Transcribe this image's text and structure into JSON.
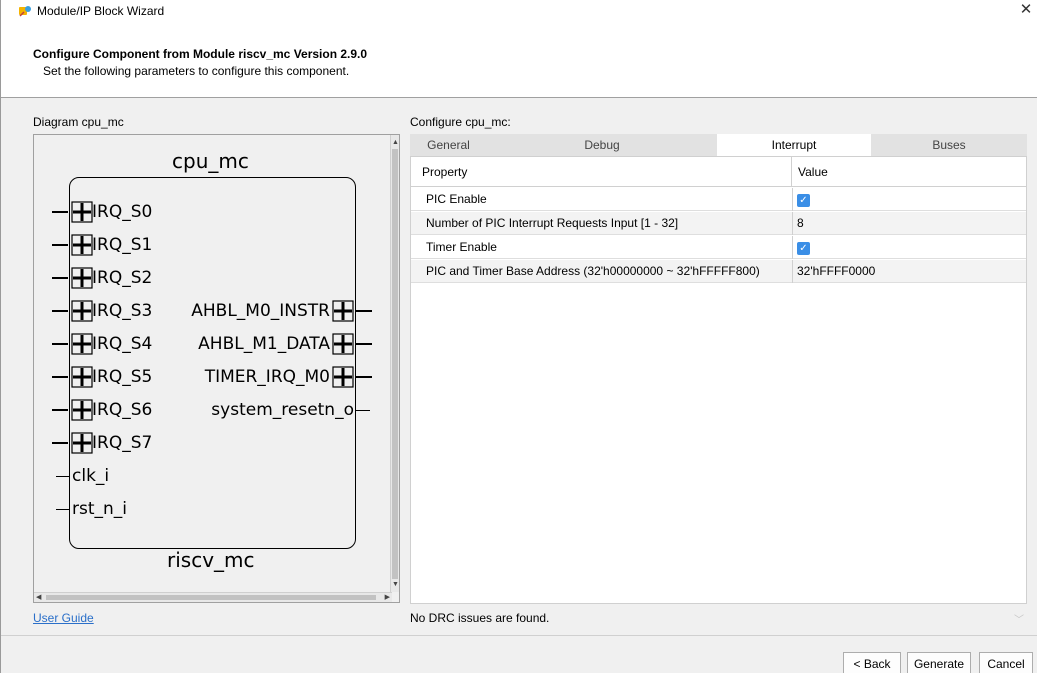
{
  "window": {
    "title": "Module/IP Block Wizard",
    "close_glyph": "✕"
  },
  "header": {
    "title": "Configure Component from Module riscv_mc Version 2.9.0",
    "subtitle": "Set the following parameters to configure this component."
  },
  "diagram": {
    "label": "Diagram cpu_mc",
    "component_name": "cpu_mc",
    "module_name": "riscv_mc",
    "left_ports": [
      "IRQ_S0",
      "IRQ_S1",
      "IRQ_S2",
      "IRQ_S3",
      "IRQ_S4",
      "IRQ_S5",
      "IRQ_S6",
      "IRQ_S7",
      "clk_i",
      "rst_n_i"
    ],
    "right_ports": [
      "AHBL_M0_INSTR",
      "AHBL_M1_DATA",
      "TIMER_IRQ_M0",
      "system_resetn_o"
    ]
  },
  "config": {
    "label": "Configure cpu_mc:",
    "tabs": [
      "General",
      "Debug",
      "Interrupt",
      "Buses"
    ],
    "active_tab": "Interrupt",
    "columns": {
      "property": "Property",
      "value": "Value"
    },
    "rows": [
      {
        "property": "PIC Enable",
        "value": "",
        "checked": true
      },
      {
        "property": "Number of PIC Interrupt Requests Input  [1 - 32]",
        "value": "8"
      },
      {
        "property": "Timer Enable",
        "value": "",
        "checked": true
      },
      {
        "property": "PIC and Timer Base Address (32'h00000000 ~ 32'hFFFFF800)",
        "value": "32'hFFFF0000"
      }
    ],
    "drc_status": "No DRC issues are found."
  },
  "links": {
    "user_guide": "User Guide"
  },
  "buttons": {
    "back": "< Back",
    "generate": "Generate",
    "cancel": "Cancel"
  },
  "icons": {
    "app": "wizard-icon",
    "check": "check-icon",
    "bus": "bus-port-icon"
  },
  "colors": {
    "link": "#2a6fc9",
    "checkbox": "#3a8ee6",
    "active_tab": "#ffffff"
  }
}
